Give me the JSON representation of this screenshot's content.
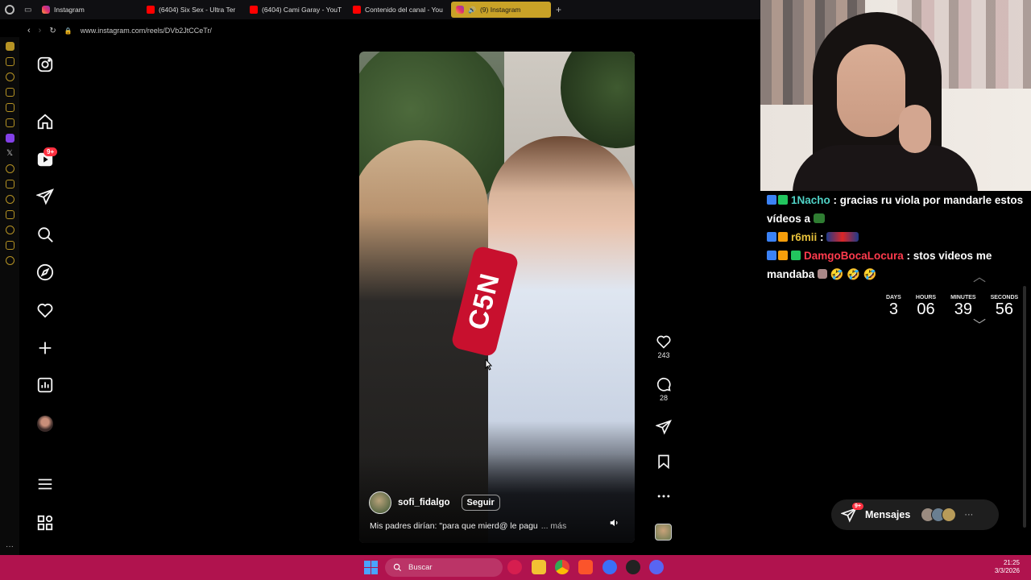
{
  "browser": {
    "tabs": [
      {
        "label": "Instagram",
        "icon": "instagram-icon"
      },
      {
        "label": "(6404) Six Sex - Ultra Ter",
        "icon": "youtube-icon"
      },
      {
        "label": "(6404) Cami Garay - YouT",
        "icon": "youtube-icon"
      },
      {
        "label": "Contenido del canal - You",
        "icon": "youtube-icon"
      },
      {
        "label": "(9) Instagram",
        "icon": "instagram-icon",
        "active": true
      }
    ],
    "new_tab_glyph": "+",
    "url": "www.instagram.com/reels/DVb2JtCCeTr/",
    "accent": "#c9a227"
  },
  "instagram": {
    "nav": [
      {
        "name": "instagram-logo",
        "icon": "instagram-icon"
      },
      {
        "name": "home",
        "icon": "home-icon"
      },
      {
        "name": "reels",
        "icon": "reels-icon"
      },
      {
        "name": "messages",
        "icon": "send-icon",
        "badge": "9+"
      },
      {
        "name": "search",
        "icon": "search-icon"
      },
      {
        "name": "explore",
        "icon": "compass-icon"
      },
      {
        "name": "notifications",
        "icon": "heart-icon"
      },
      {
        "name": "create",
        "icon": "plus-icon"
      },
      {
        "name": "dashboard",
        "icon": "chart-icon"
      },
      {
        "name": "profile",
        "icon": "avatar"
      },
      {
        "name": "more",
        "icon": "menu-icon"
      },
      {
        "name": "also-from-meta",
        "icon": "grid-icon"
      }
    ],
    "badge": "9+",
    "reel": {
      "mic_brand": "C5N",
      "author": "sofi_fidalgo",
      "follow_label": "Seguir",
      "caption": "Mis padres dirían: \"para que mierd@ le pagu",
      "more_label": "... más",
      "likes": "243",
      "comments": "28"
    },
    "messages_pill": {
      "label": "Mensajes",
      "badge": "9+"
    }
  },
  "stream": {
    "chat": [
      {
        "user": "1Nacho",
        "text": ": gracias ru viola por mandarle estos vídeos a"
      },
      {
        "user": "r6mii",
        "text": ":"
      },
      {
        "user": "DamgoBocaLocura",
        "text": ": stos videos me mandaba"
      }
    ],
    "countdown": [
      {
        "label": "DAYS",
        "value": "3"
      },
      {
        "label": "HOURS",
        "value": "06"
      },
      {
        "label": "MINUTES",
        "value": "39"
      },
      {
        "label": "SECONDS",
        "value": "56"
      }
    ]
  },
  "taskbar": {
    "search_placeholder": "Buscar",
    "time": "21:25",
    "date": "3/3/2026",
    "color": "#b0134e"
  }
}
